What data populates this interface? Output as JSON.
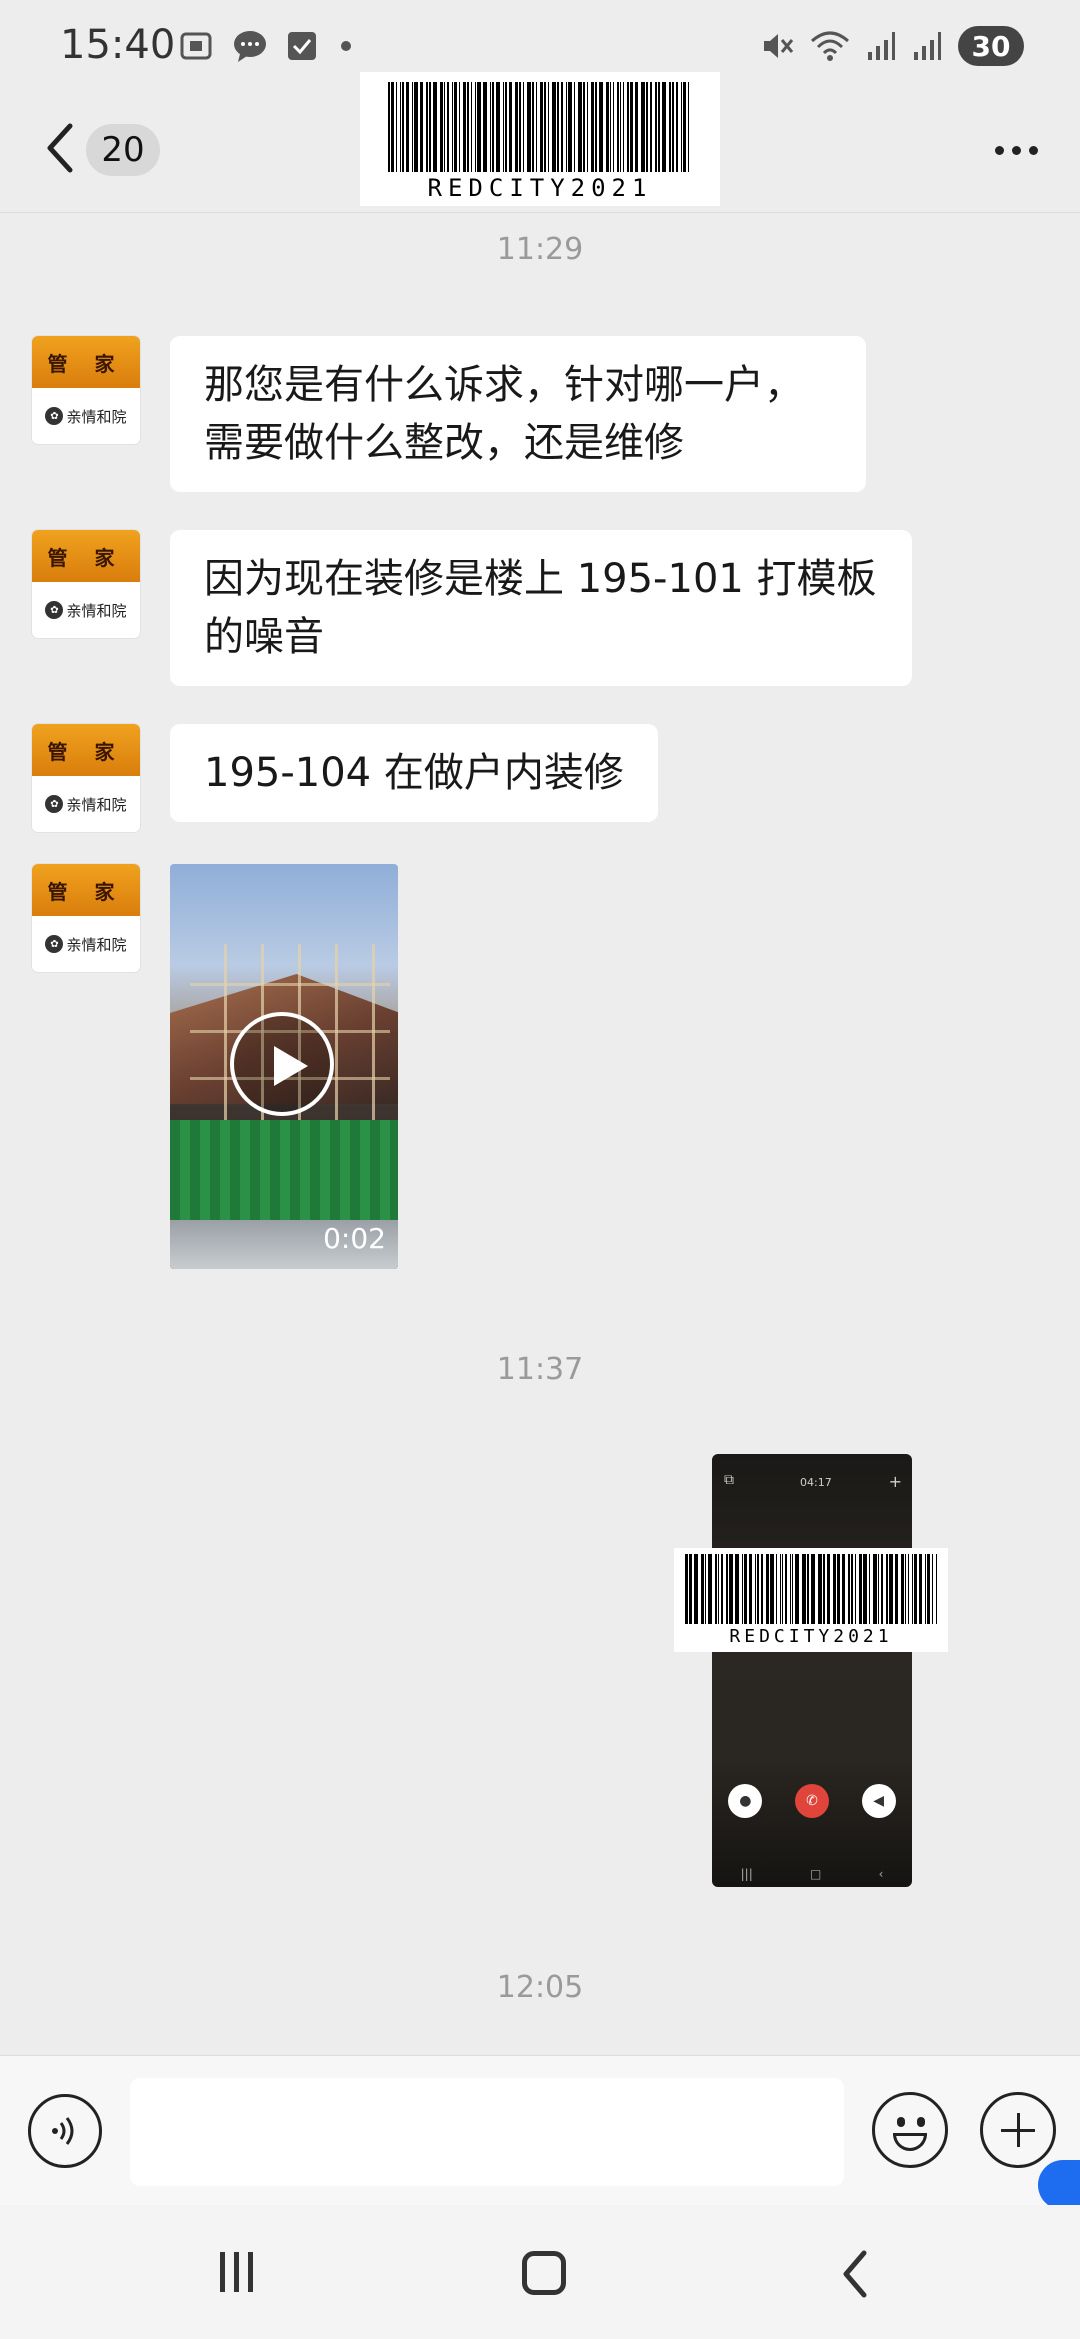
{
  "status_bar": {
    "time": "15:40",
    "battery_level": "30",
    "icons_left": [
      "screenshot-icon",
      "message-icon",
      "checkbox-icon",
      "dot-icon"
    ],
    "icons_right": [
      "mute-icon",
      "wifi-icon",
      "signal-icon",
      "signal-icon"
    ]
  },
  "header": {
    "unread_count": "20",
    "watermark_text": "REDCITY2021"
  },
  "messages": {
    "time_1": "11:29",
    "sender_avatar_top": "管 家",
    "sender_avatar_bottom": "亲情和院",
    "msg_1": "那您是有什么诉求，针对哪一户，需要做什么整改，还是维修",
    "msg_2": "因为现在装修是楼上 195-101 打模板的噪音",
    "msg_3": "195-104 在做户内装修",
    "video_duration": "0:02",
    "time_2": "11:37",
    "screenshot_time_top": "04:17",
    "screenshot_watermark": "REDCITY2021",
    "time_3": "12:05"
  },
  "input_bar": {
    "placeholder": ""
  },
  "colors": {
    "background": "#ededed",
    "bubble": "#ffffff",
    "accent_blue": "#1e6cf0"
  }
}
